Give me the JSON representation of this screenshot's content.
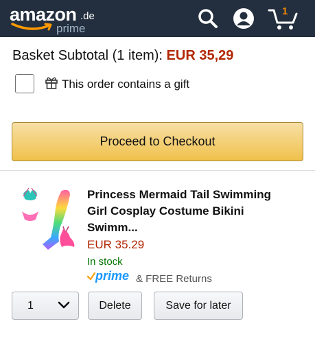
{
  "header": {
    "logo_word": "amazon",
    "logo_tld": ".de",
    "logo_prime": "prime",
    "cart_count": "1",
    "colors": {
      "bar": "#232f3e",
      "smile": "#ff9900",
      "cart_count": "#f08804"
    }
  },
  "basket": {
    "subtotal_label": "Basket Subtotal (1 item):",
    "subtotal_price": "EUR 35,29",
    "gift_label": "This order contains a gift",
    "gift_checked": false,
    "checkout_label": "Proceed to Checkout"
  },
  "item": {
    "title": "Princess Mermaid Tail Swimming Girl Cosplay Costume Bikini Swimm...",
    "price": "EUR 35.29",
    "stock": "In stock",
    "prime": "prime",
    "returns": "& FREE Returns",
    "quantity": "1",
    "delete_label": "Delete",
    "save_label": "Save for later"
  },
  "icons": [
    "search-icon",
    "account-icon",
    "cart-icon",
    "gift-icon",
    "chevron-down-icon",
    "prime-check-icon"
  ],
  "colors": {
    "price": "#b12704",
    "in_stock": "#007600",
    "prime": "#1a98ff",
    "checkout": "#f0c14b"
  }
}
